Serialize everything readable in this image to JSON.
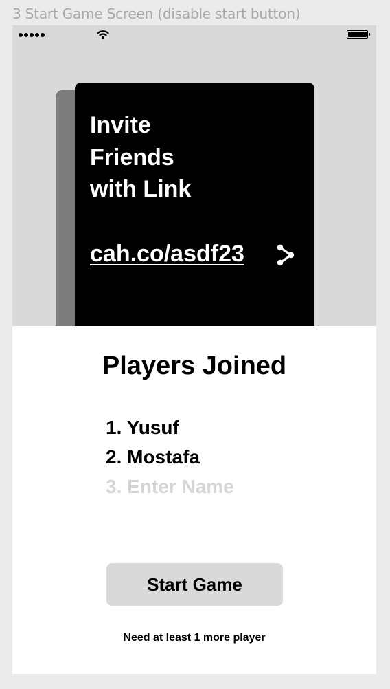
{
  "frame": {
    "label": "3 Start Game Screen (disable start button)"
  },
  "status_bar": {
    "signal_icon": "signal-dots-icon",
    "wifi_icon": "wifi-icon",
    "battery_icon": "battery-icon",
    "battery_level": 1.0
  },
  "invite_card": {
    "lines": [
      "Invite",
      "Friends",
      "with Link"
    ],
    "link_text": "cah.co/asdf23",
    "share_icon": "share-icon"
  },
  "players": {
    "title": "Players Joined",
    "list": [
      {
        "text": "1. Yusuf",
        "placeholder": false
      },
      {
        "text": "2. Mostafa",
        "placeholder": false
      },
      {
        "text": "3. Enter Name",
        "placeholder": true
      }
    ]
  },
  "start_button": {
    "label": "Start Game",
    "disabled": true
  },
  "helper": {
    "text": "Need at least 1 more player"
  },
  "colors": {
    "page_background": "#ebebeb",
    "top_area": "#d9d9d9",
    "card": "#000000",
    "card_shadow": "#7d7d7d",
    "disabled_button": "#d9d9d9",
    "placeholder_text": "#d5d5d5",
    "frame_label": "#a8a8a8"
  }
}
